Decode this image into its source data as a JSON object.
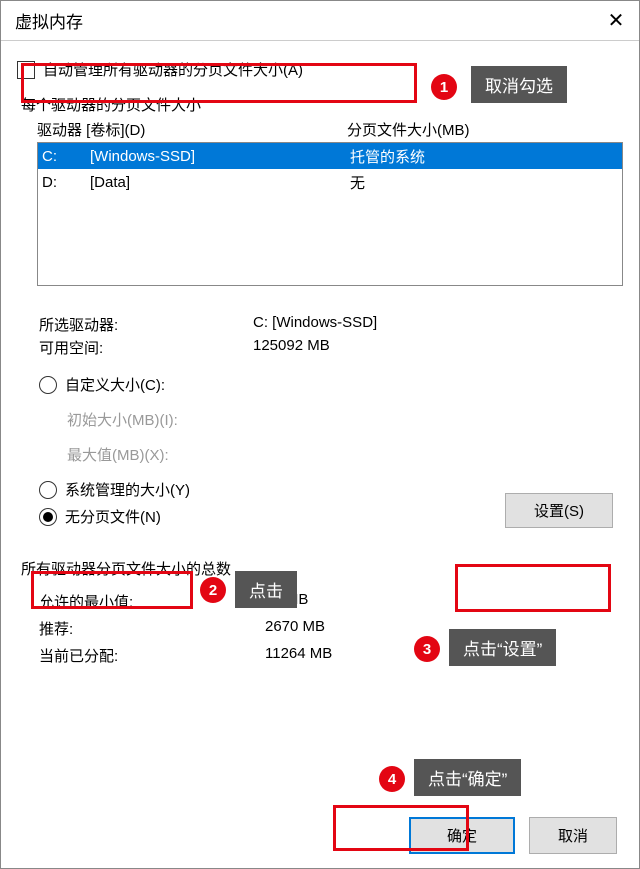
{
  "title": "虚拟内存",
  "checkbox_label": "自动管理所有驱动器的分页文件大小(A)",
  "subtitle": "每个驱动器的分页文件大小",
  "table": {
    "head_drive": "驱动器 [卷标](D)",
    "head_size": "分页文件大小(MB)",
    "rows": [
      {
        "drive": "C:",
        "label": "[Windows-SSD]",
        "size": "托管的系统",
        "selected": true
      },
      {
        "drive": "D:",
        "label": "[Data]",
        "size": "无",
        "selected": false
      }
    ]
  },
  "info": {
    "selected_drive_label": "所选驱动器:",
    "selected_drive_value": "C:  [Windows-SSD]",
    "free_space_label": "可用空间:",
    "free_space_value": "125092 MB"
  },
  "radios": {
    "custom": "自定义大小(C):",
    "initial_label": "初始大小(MB)(I):",
    "max_label": "最大值(MB)(X):",
    "system": "系统管理的大小(Y)",
    "none": "无分页文件(N)"
  },
  "set_button": "设置(S)",
  "totals": {
    "title": "所有驱动器分页文件大小的总数",
    "min_label": "允许的最小值:",
    "min_value": "16 MB",
    "rec_label": "推荐:",
    "rec_value": "2670 MB",
    "cur_label": "当前已分配:",
    "cur_value": "11264 MB"
  },
  "ok": "确定",
  "cancel": "取消",
  "annotations": {
    "a1": "取消勾选",
    "a2": "点击",
    "a3": "点击“设置”",
    "a4": "点击“确定”"
  }
}
